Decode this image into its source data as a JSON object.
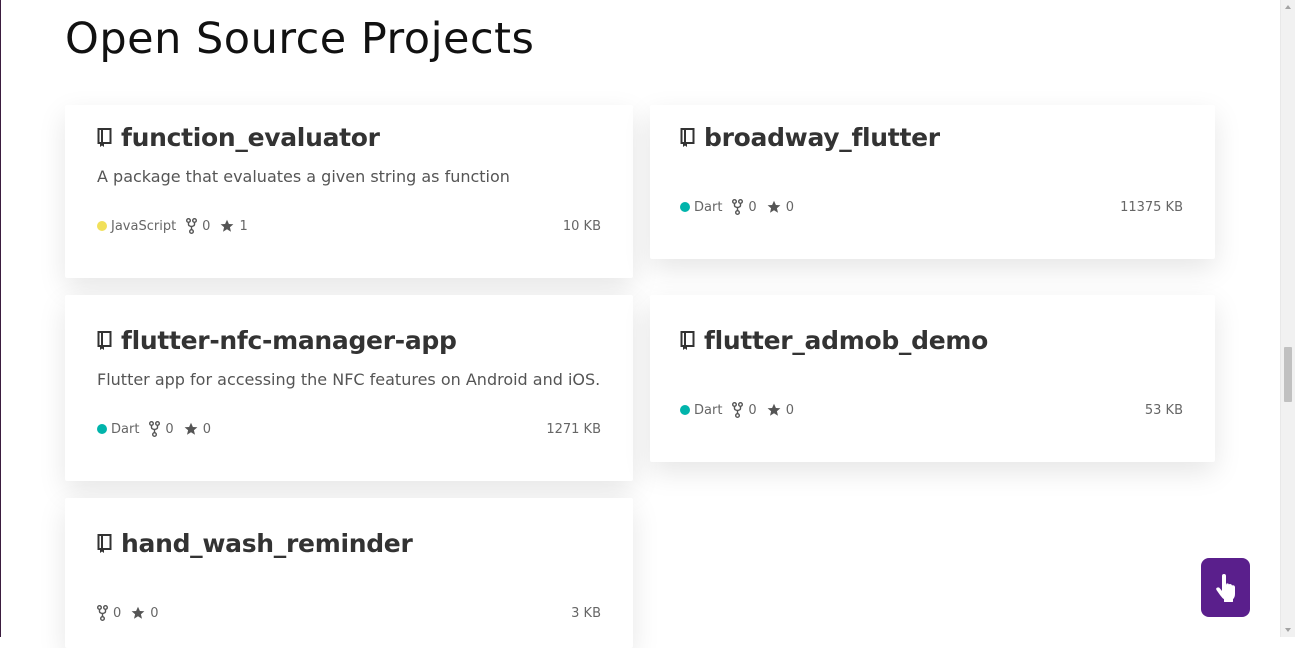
{
  "page": {
    "title": "Open Source Projects"
  },
  "colors": {
    "javascript": "#f1e05a",
    "dart": "#00b4ab",
    "fab_background": "#5a1f8c"
  },
  "projects": [
    {
      "name": "function_evaluator",
      "description": "A package that evaluates a given string as function",
      "language": "JavaScript",
      "forks": "0",
      "stars": "1",
      "size": "10 KB"
    },
    {
      "name": "broadway_flutter",
      "description": "",
      "language": "Dart",
      "forks": "0",
      "stars": "0",
      "size": "11375 KB"
    },
    {
      "name": "flutter-nfc-manager-app",
      "description": "Flutter app for accessing the NFC features on Android and iOS.",
      "language": "Dart",
      "forks": "0",
      "stars": "0",
      "size": "1271 KB"
    },
    {
      "name": "flutter_admob_demo",
      "description": "",
      "language": "Dart",
      "forks": "0",
      "stars": "0",
      "size": "53 KB"
    },
    {
      "name": "hand_wash_reminder",
      "description": "",
      "language": "",
      "forks": "0",
      "stars": "0",
      "size": "3 KB"
    }
  ],
  "icons": {
    "repo": "repo-icon",
    "fork": "fork-icon",
    "star": "star-icon",
    "fab": "pointing-hand-icon"
  }
}
